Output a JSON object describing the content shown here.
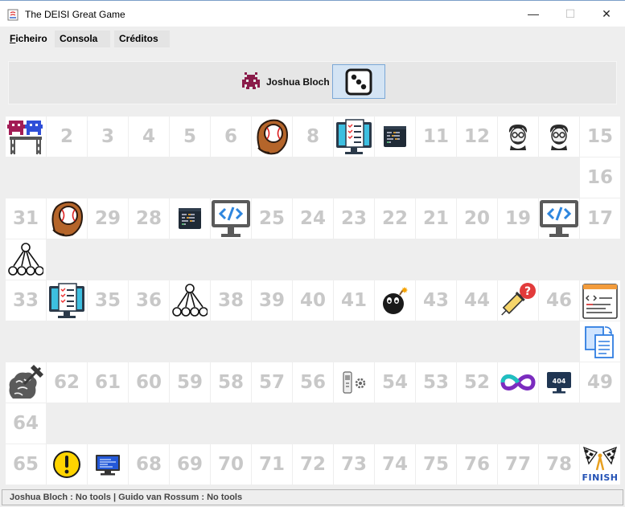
{
  "window": {
    "title": "The DEISI Great Game",
    "minimize_glyph": "—",
    "maximize_glyph": "☐",
    "close_glyph": "✕"
  },
  "menu": {
    "items": [
      {
        "label": "Ficheiro",
        "mnemonic": "F"
      },
      {
        "label": "Consola"
      },
      {
        "label": "Créditos"
      }
    ]
  },
  "current_player": {
    "name": "Joshua Bloch",
    "icon": "space-invader-icon"
  },
  "board": {
    "cells": [
      {
        "n": 1,
        "label": "",
        "icon": "space-invaders-start-icon"
      },
      {
        "n": 2,
        "label": "2"
      },
      {
        "n": 3,
        "label": "3"
      },
      {
        "n": 4,
        "label": "4"
      },
      {
        "n": 5,
        "label": "5"
      },
      {
        "n": 6,
        "label": "6"
      },
      {
        "n": 7,
        "label": "",
        "icon": "baseball-glove-icon"
      },
      {
        "n": 8,
        "label": "8"
      },
      {
        "n": 9,
        "label": "",
        "icon": "monitor-checklist-icon"
      },
      {
        "n": 10,
        "label": "",
        "icon": "code-terminal-icon"
      },
      {
        "n": 11,
        "label": "11"
      },
      {
        "n": 12,
        "label": "12"
      },
      {
        "n": 13,
        "label": "",
        "icon": "programmer-face-icon"
      },
      {
        "n": 14,
        "label": "",
        "icon": "programmer-face-icon"
      },
      {
        "n": 15,
        "label": "15"
      },
      {
        "n": 16,
        "label": "16"
      },
      {
        "n": 17,
        "label": "17"
      },
      {
        "n": 18,
        "label": "",
        "icon": "monitor-code-icon"
      },
      {
        "n": 19,
        "label": "19"
      },
      {
        "n": 20,
        "label": "20"
      },
      {
        "n": 21,
        "label": "21"
      },
      {
        "n": 22,
        "label": "22"
      },
      {
        "n": 23,
        "label": "23"
      },
      {
        "n": 24,
        "label": "24"
      },
      {
        "n": 25,
        "label": "25"
      },
      {
        "n": 26,
        "label": "",
        "icon": "monitor-code-icon"
      },
      {
        "n": 27,
        "label": "",
        "icon": "code-terminal-icon"
      },
      {
        "n": 28,
        "label": "28"
      },
      {
        "n": 29,
        "label": "29"
      },
      {
        "n": 30,
        "label": "",
        "icon": "baseball-glove-icon"
      },
      {
        "n": 31,
        "label": "31"
      },
      {
        "n": 32,
        "label": "",
        "icon": "tree-diagram-icon"
      },
      {
        "n": 33,
        "label": "33"
      },
      {
        "n": 34,
        "label": "",
        "icon": "monitor-checklist-icon"
      },
      {
        "n": 35,
        "label": "35"
      },
      {
        "n": 36,
        "label": "36"
      },
      {
        "n": 37,
        "label": "",
        "icon": "tree-diagram-icon"
      },
      {
        "n": 38,
        "label": "38"
      },
      {
        "n": 39,
        "label": "39"
      },
      {
        "n": 40,
        "label": "40"
      },
      {
        "n": 41,
        "label": "41"
      },
      {
        "n": 42,
        "label": "",
        "icon": "bomb-icon"
      },
      {
        "n": 43,
        "label": "43"
      },
      {
        "n": 44,
        "label": "44"
      },
      {
        "n": 45,
        "label": "",
        "icon": "syringe-question-icon"
      },
      {
        "n": 46,
        "label": "46"
      },
      {
        "n": 47,
        "label": "",
        "icon": "code-document-icon"
      },
      {
        "n": 48,
        "label": "",
        "icon": "copy-files-icon"
      },
      {
        "n": 49,
        "label": "49"
      },
      {
        "n": 50,
        "label": "",
        "icon": "error-404-icon"
      },
      {
        "n": 51,
        "label": "",
        "icon": "infinite-loop-icon"
      },
      {
        "n": 52,
        "label": "52"
      },
      {
        "n": 53,
        "label": "53"
      },
      {
        "n": 54,
        "label": "54"
      },
      {
        "n": 55,
        "label": "",
        "icon": "robot-gear-icon"
      },
      {
        "n": 56,
        "label": "56"
      },
      {
        "n": 57,
        "label": "57"
      },
      {
        "n": 58,
        "label": "58"
      },
      {
        "n": 59,
        "label": "59"
      },
      {
        "n": 60,
        "label": "60"
      },
      {
        "n": 61,
        "label": "61"
      },
      {
        "n": 62,
        "label": "62"
      },
      {
        "n": 63,
        "label": "",
        "icon": "brain-hammer-icon"
      },
      {
        "n": 64,
        "label": "64"
      },
      {
        "n": 65,
        "label": "65"
      },
      {
        "n": 66,
        "label": "",
        "icon": "warning-exclamation-icon"
      },
      {
        "n": 67,
        "label": "",
        "icon": "blue-screen-icon"
      },
      {
        "n": 68,
        "label": "68"
      },
      {
        "n": 69,
        "label": "69"
      },
      {
        "n": 70,
        "label": "70"
      },
      {
        "n": 71,
        "label": "71"
      },
      {
        "n": 72,
        "label": "72"
      },
      {
        "n": 73,
        "label": "73"
      },
      {
        "n": 74,
        "label": "74"
      },
      {
        "n": 75,
        "label": "75"
      },
      {
        "n": 76,
        "label": "76"
      },
      {
        "n": 77,
        "label": "77"
      },
      {
        "n": 78,
        "label": "78"
      },
      {
        "n": 79,
        "label": "FINISH",
        "icon": "finish-flags-icon"
      }
    ]
  },
  "status": {
    "text": "Joshua Bloch : No tools | Guido van Rossum : No tools"
  },
  "colors": {
    "number": "#c8c8c8",
    "dice_bg": "#d4e4f4",
    "panel_bg": "#eeeeee"
  }
}
